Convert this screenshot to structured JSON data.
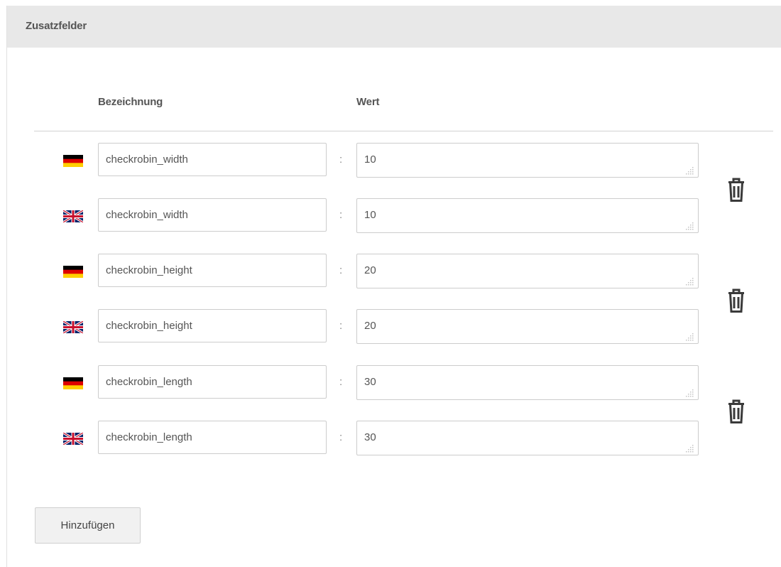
{
  "panel": {
    "title": "Zusatzfelder"
  },
  "columns": {
    "name_header": "Bezeichnung",
    "value_header": "Wert"
  },
  "separator": ":",
  "rows": [
    {
      "language": "de",
      "flag_icon": "germany-flag-icon",
      "name": "checkrobin_width",
      "value": "10"
    },
    {
      "language": "en",
      "flag_icon": "uk-flag-icon",
      "name": "checkrobin_width",
      "value": "10"
    },
    {
      "language": "de",
      "flag_icon": "germany-flag-icon",
      "name": "checkrobin_height",
      "value": "20"
    },
    {
      "language": "en",
      "flag_icon": "uk-flag-icon",
      "name": "checkrobin_height",
      "value": "20"
    },
    {
      "language": "de",
      "flag_icon": "germany-flag-icon",
      "name": "checkrobin_length",
      "value": "30"
    },
    {
      "language": "en",
      "flag_icon": "uk-flag-icon",
      "name": "checkrobin_length",
      "value": "30"
    }
  ],
  "delete_icon": "trash-icon",
  "actions": {
    "add_label": "Hinzufügen"
  },
  "colors": {
    "header_background": "#e8e8e8",
    "text": "#555555",
    "border": "#cccccc"
  }
}
